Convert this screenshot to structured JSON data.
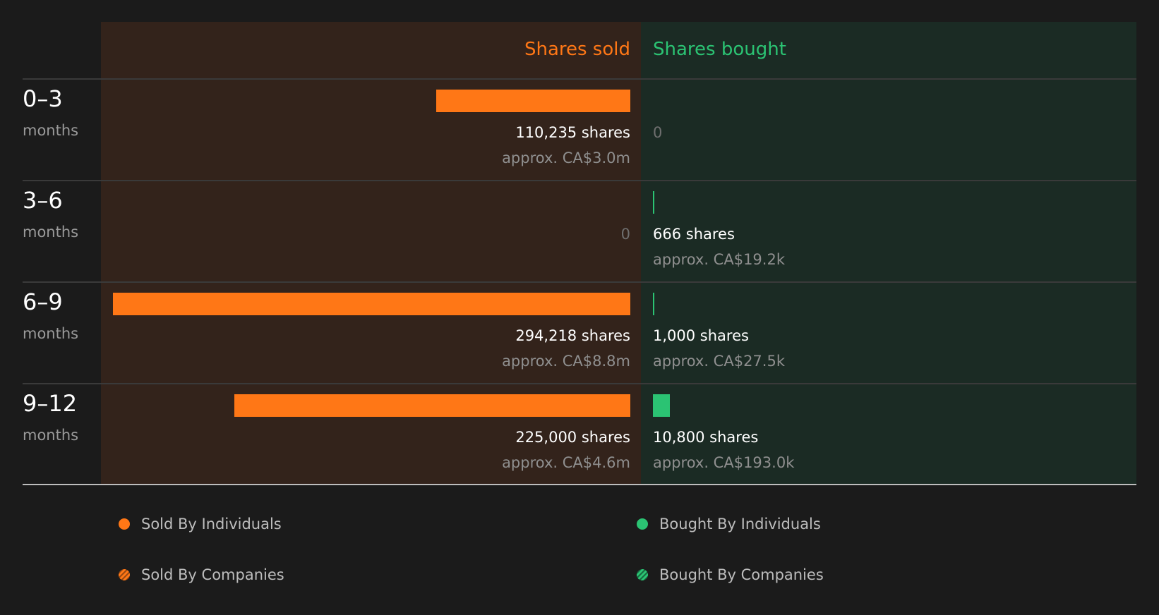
{
  "colors": {
    "sold": "#ff7716",
    "bought": "#2bc373",
    "sold_company_stripe": "#9a4a12",
    "bought_company_stripe": "#176a41"
  },
  "header": {
    "sold_label": "Shares sold",
    "bought_label": "Shares bought"
  },
  "chart_data": {
    "type": "bar",
    "categories": [
      "0–3",
      "3–6",
      "6–9",
      "9–12"
    ],
    "category_unit": "months",
    "series": [
      {
        "name": "Shares sold",
        "values": [
          110235,
          0,
          294218,
          225000
        ],
        "labels": [
          "110,235 shares",
          "0",
          "294,218 shares",
          "225,000 shares"
        ],
        "approx": [
          "approx. CA$3.0m",
          "",
          "approx. CA$8.8m",
          "approx. CA$4.6m"
        ]
      },
      {
        "name": "Shares bought",
        "values": [
          0,
          666,
          1000,
          10800
        ],
        "labels": [
          "0",
          "666 shares",
          "1,000 shares",
          "10,800 shares"
        ],
        "approx": [
          "",
          "approx. CA$19.2k",
          "approx. CA$27.5k",
          "approx. CA$193.0k"
        ]
      }
    ],
    "xlim": [
      0,
      294218
    ],
    "legend_position": "bottom",
    "legend": [
      {
        "label": "Sold By Individuals",
        "style": "solid",
        "color": "#ff7716"
      },
      {
        "label": "Bought By Individuals",
        "style": "solid",
        "color": "#2bc373"
      },
      {
        "label": "Sold By Companies",
        "style": "striped",
        "color": "#ff7716"
      },
      {
        "label": "Bought By Companies",
        "style": "striped",
        "color": "#2bc373"
      }
    ]
  }
}
